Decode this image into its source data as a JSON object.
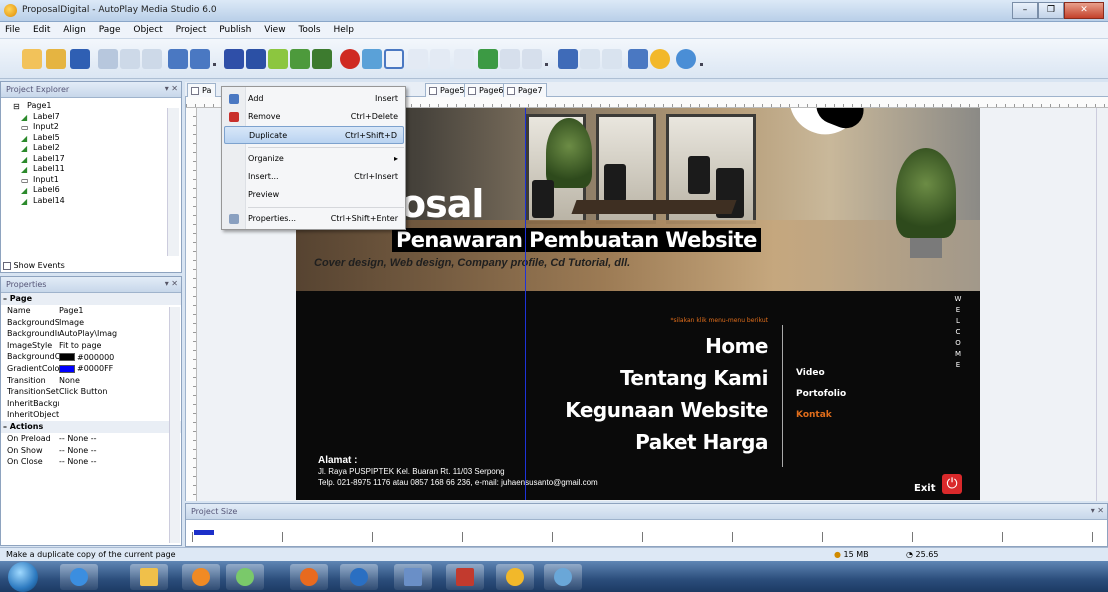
{
  "window": {
    "title": "ProposalDigital - AutoPlay Media Studio 6.0",
    "minimize": "–",
    "restore": "❐",
    "close": "✕"
  },
  "menu": [
    "File",
    "Edit",
    "Align",
    "Page",
    "Object",
    "Project",
    "Publish",
    "View",
    "Tools",
    "Help"
  ],
  "project_explorer": {
    "title": "Project Explorer",
    "buttons": "▾ ✕",
    "root": "Page1",
    "items": [
      "Label7",
      "Input2",
      "Label5",
      "Label2",
      "Label17",
      "Label11",
      "Input1",
      "Label6",
      "Label14"
    ],
    "show_events": "Show Events"
  },
  "properties": {
    "title": "Properties",
    "buttons": "▾ ✕",
    "category_page": "Page",
    "rows": [
      {
        "name": "Name",
        "value": "Page1"
      },
      {
        "name": "BackgroundStyl",
        "value": "Image"
      },
      {
        "name": "BackgroundIma",
        "value": "AutoPlay\\Imag"
      },
      {
        "name": "ImageStyle",
        "value": "Fit to page"
      },
      {
        "name": "BackgroundCol",
        "value": "#000000",
        "color": "#000000"
      },
      {
        "name": "GradientColor",
        "value": "#0000FF",
        "color": "#0000ff"
      },
      {
        "name": "Transition",
        "value": "None"
      },
      {
        "name": "TransitionSettin",
        "value": "Click Button"
      },
      {
        "name": "InheritBackgrou",
        "value": ""
      },
      {
        "name": "InheritObjects",
        "value": ""
      }
    ],
    "category_actions": "Actions",
    "actions": [
      {
        "name": "On Preload",
        "value": "-- None --"
      },
      {
        "name": "On Show",
        "value": "-- None --"
      },
      {
        "name": "On Close",
        "value": "-- None --"
      }
    ]
  },
  "tabs": [
    "Pa",
    "Page5",
    "Page6",
    "Page7"
  ],
  "context_menu": {
    "items": [
      {
        "label": "Add",
        "shortcut": "Insert"
      },
      {
        "label": "Remove",
        "shortcut": "Ctrl+Delete"
      },
      {
        "label": "Duplicate",
        "shortcut": "Ctrl+Shift+D"
      },
      {
        "label": "Organize",
        "shortcut": "▸"
      },
      {
        "label": "Insert...",
        "shortcut": "Ctrl+Insert"
      },
      {
        "label": "Preview",
        "shortcut": ""
      },
      {
        "label": "Properties...",
        "shortcut": "Ctrl+Shift+Enter"
      }
    ]
  },
  "canvas": {
    "title": "osal",
    "subtitle": "Penawaran Pembuatan Website",
    "tagline": "Cover design, Web design, Company profile, Cd Tutorial, dll.",
    "welcome": "W E L C O M E",
    "hint": "*silakan klik menu-menu berikut",
    "nav_main": [
      "Home",
      "Tentang Kami",
      "Kegunaan Website",
      "Paket Harga"
    ],
    "nav_side": [
      "Video",
      "Portofolio",
      "Kontak"
    ],
    "address_label": "Alamat :",
    "address_line1": "Jl. Raya PUSPIPTEK Kel. Buaran Rt. 11/03 Serpong",
    "address_line2": "Telp. 021-8975 1176 atau 0857 168 66 236, e-mail: juhaensusanto@gmail.com",
    "exit": "Exit"
  },
  "project_size": {
    "title": "Project Size",
    "buttons": "▾ ✕"
  },
  "status": {
    "message": "Make a duplicate copy of the current page",
    "size": "15 MB",
    "percent": "25.65"
  },
  "colors": {
    "accent_orange": "#e06d1b",
    "guide_blue": "#1e32d8",
    "exit_red": "#d9292b"
  }
}
